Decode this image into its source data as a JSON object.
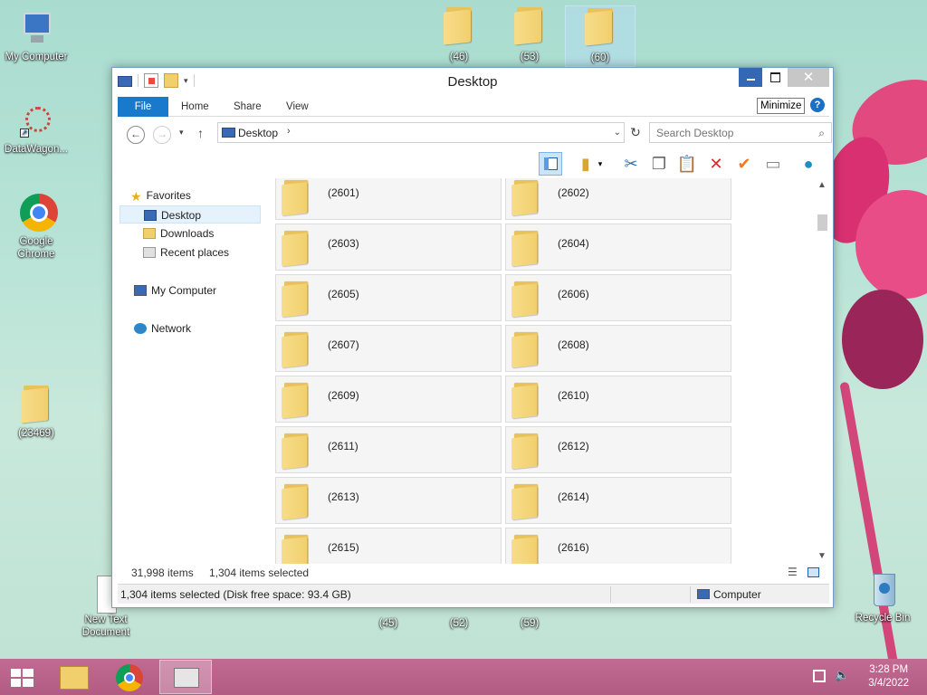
{
  "desktop": {
    "icons": [
      {
        "label": "My Computer"
      },
      {
        "label": "DataWagon..."
      },
      {
        "label": "Google Chrome"
      },
      {
        "label": "(23469)"
      },
      {
        "label": "(46)"
      },
      {
        "label": "(53)"
      },
      {
        "label": "(60)"
      },
      {
        "label": "New Text Document"
      },
      {
        "label": "(45)"
      },
      {
        "label": "(52)"
      },
      {
        "label": "(59)"
      },
      {
        "label": "Recycle Bin"
      }
    ]
  },
  "window": {
    "title": "Desktop",
    "close_glyph": "✕",
    "tooltip": "Minimize",
    "help": "?",
    "ribbon_tabs": [
      "File",
      "Home",
      "Share",
      "View"
    ],
    "address": {
      "location": "Desktop",
      "sep": "›"
    },
    "search": {
      "placeholder": "Search Desktop"
    },
    "nav": {
      "favorites": "Favorites",
      "desktop": "Desktop",
      "downloads": "Downloads",
      "recent": "Recent places",
      "computer": "My Computer",
      "network": "Network"
    },
    "folders": [
      "(2601)",
      "(2602)",
      "(2603)",
      "(2604)",
      "(2605)",
      "(2606)",
      "(2607)",
      "(2608)",
      "(2609)",
      "(2610)",
      "(2611)",
      "(2612)",
      "(2613)",
      "(2614)",
      "(2615)",
      "(2616)"
    ],
    "status": {
      "items": "31,998 items",
      "selected": "1,304 items selected",
      "detail": "1,304 items selected (Disk free space: 93.4 GB)",
      "location": "Computer"
    }
  },
  "taskbar": {
    "time": "3:28 PM",
    "date": "3/4/2022"
  },
  "colors": {
    "accent": "#1979ca",
    "taskbar": "#b96088"
  }
}
